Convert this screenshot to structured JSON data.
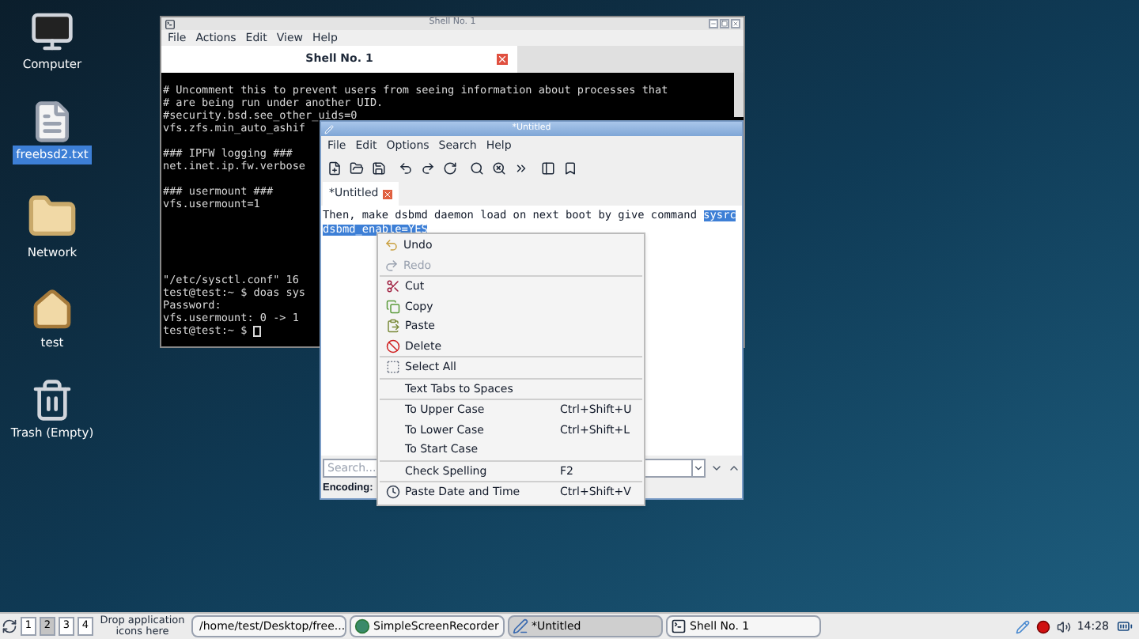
{
  "desktop_icons": [
    {
      "kind": "computer",
      "label": "Computer",
      "selected": false
    },
    {
      "kind": "file",
      "label": "freebsd2.txt",
      "selected": true
    },
    {
      "kind": "folder",
      "label": "Network",
      "selected": false
    },
    {
      "kind": "home",
      "label": "test",
      "selected": false
    },
    {
      "kind": "trash",
      "label": "Trash (Empty)",
      "selected": false
    }
  ],
  "shell_window": {
    "title": "Shell No. 1",
    "menu": [
      "File",
      "Actions",
      "Edit",
      "View",
      "Help"
    ],
    "tab": {
      "label": "Shell No. 1"
    },
    "blocks": [
      {
        "kind": "first",
        "lines": [
          "# Uncomment this to prevent users from seeing information about processes that",
          "# are being run under another UID.",
          "#security.bsd.see_other_uids=0",
          "vfs.zfs.min_auto_ashif"
        ]
      },
      {
        "kind": "blank",
        "lines": [
          "### IPFW logging ###",
          "net.inet.ip.fw.verbose"
        ]
      },
      {
        "kind": "blank",
        "lines": [
          "### usermount ###",
          "vfs.usermount=1"
        ]
      },
      {
        "kind": "gap",
        "lines": [
          "\"/etc/sysctl.conf\" 16",
          "test@test:~ $ doas sys",
          "Password:",
          "vfs.usermount: 0 -> 1",
          "test@test:~ $"
        ]
      }
    ]
  },
  "editor_window": {
    "title": "*Untitled",
    "menu": [
      "File",
      "Edit",
      "Options",
      "Search",
      "Help"
    ],
    "tab": {
      "label": "*Untitled"
    },
    "text_lines": [
      [
        {
          "text": "Then, make dsbmd daemon load on next boot by give command ",
          "selected": false
        },
        {
          "text": "sysrc",
          "selected": true
        }
      ],
      [
        {
          "text": "dsbmd_enable=YES",
          "selected": true
        }
      ]
    ],
    "search": {
      "placeholder": "Search..."
    },
    "encoding_label": "Encoding:"
  },
  "context_menu": [
    [
      {
        "kind": "undo",
        "label": "Undo",
        "disabled": false
      },
      {
        "kind": "redo",
        "label": "Redo",
        "disabled": true
      }
    ],
    [
      {
        "kind": "cut",
        "label": "Cut",
        "disabled": false
      },
      {
        "kind": "copy",
        "label": "Copy",
        "disabled": false
      },
      {
        "kind": "paste",
        "label": "Paste",
        "disabled": false
      },
      {
        "kind": "delete",
        "label": "Delete",
        "disabled": false
      }
    ],
    [
      {
        "kind": "select",
        "label": "Select All",
        "disabled": false
      }
    ],
    [
      {
        "kind": "plain",
        "label": "Text Tabs to Spaces",
        "disabled": false
      }
    ],
    [
      {
        "kind": "plain",
        "label": "To Upper Case",
        "shortcut": "Ctrl+Shift+U",
        "disabled": false
      },
      {
        "kind": "plain",
        "label": "To Lower Case",
        "shortcut": "Ctrl+Shift+L",
        "disabled": false
      },
      {
        "kind": "plain",
        "label": "To Start Case",
        "disabled": false
      }
    ],
    [
      {
        "kind": "plain",
        "label": "Check Spelling",
        "shortcut": "F2",
        "disabled": false
      }
    ],
    [
      {
        "kind": "clock",
        "label": "Paste Date and Time",
        "shortcut": "Ctrl+Shift+V",
        "disabled": false
      }
    ]
  ],
  "taskbar": {
    "workspaces": [
      {
        "label": "1",
        "selected": false
      },
      {
        "label": "2",
        "selected": true
      },
      {
        "label": "3",
        "selected": false
      },
      {
        "label": "4",
        "selected": false
      }
    ],
    "launcher_hint": "Drop application icons here",
    "tasks": [
      {
        "kind": "editor",
        "label": "/home/test/Desktop/free...",
        "selected": false
      },
      {
        "kind": "recorder",
        "label": "SimpleScreenRecorder",
        "selected": false
      },
      {
        "kind": "editor",
        "label": "*Untitled",
        "selected": true
      },
      {
        "kind": "terminal",
        "label": "Shell No. 1",
        "selected": false
      }
    ],
    "clock": "14:28"
  }
}
